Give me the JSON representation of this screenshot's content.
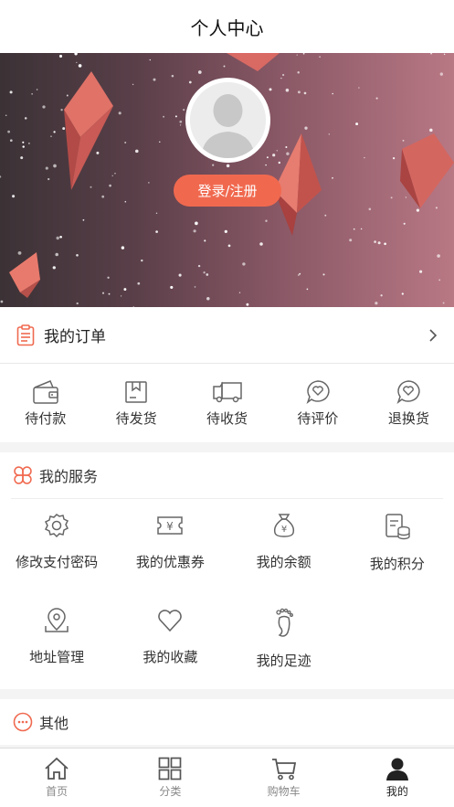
{
  "header": {
    "title": "个人中心"
  },
  "profile": {
    "login_label": "登录/注册"
  },
  "orders": {
    "title": "我的订单",
    "items": [
      {
        "label": "待付款",
        "icon": "wallet-icon"
      },
      {
        "label": "待发货",
        "icon": "package-icon"
      },
      {
        "label": "待收货",
        "icon": "truck-icon"
      },
      {
        "label": "待评价",
        "icon": "comment-icon"
      },
      {
        "label": "退换货",
        "icon": "return-icon"
      }
    ]
  },
  "services": {
    "title": "我的服务",
    "items": [
      {
        "label": "修改支付密码",
        "icon": "gear-icon"
      },
      {
        "label": "我的优惠券",
        "icon": "coupon-icon"
      },
      {
        "label": "我的余额",
        "icon": "money-bag-icon"
      },
      {
        "label": "我的积分",
        "icon": "points-icon"
      },
      {
        "label": "地址管理",
        "icon": "location-icon"
      },
      {
        "label": "我的收藏",
        "icon": "heart-icon"
      },
      {
        "label": "我的足迹",
        "icon": "footprint-icon"
      }
    ]
  },
  "other": {
    "title": "其他"
  },
  "tabbar": {
    "items": [
      {
        "label": "首页",
        "icon": "home-icon"
      },
      {
        "label": "分类",
        "icon": "grid-icon"
      },
      {
        "label": "购物车",
        "icon": "cart-icon"
      },
      {
        "label": "我的",
        "icon": "user-icon"
      }
    ],
    "active": "我的"
  },
  "colors": {
    "accent": "#f0694f",
    "icon_gray": "#666666"
  }
}
